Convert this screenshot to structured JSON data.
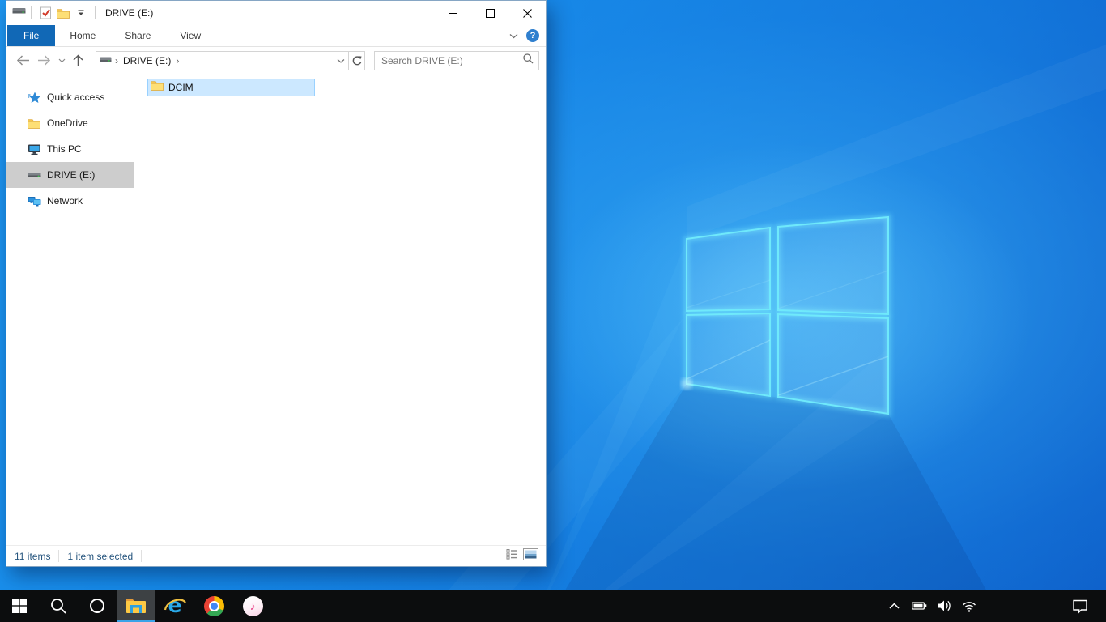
{
  "explorer": {
    "titlebar": {
      "title": "DRIVE (E:)",
      "system_icon": "drive-icon",
      "qat_icons": [
        "properties-icon",
        "new-folder-icon",
        "customize-qat-dropdown"
      ],
      "window_controls": [
        "minimize",
        "maximize",
        "close"
      ]
    },
    "ribbon": {
      "tabs": [
        "File",
        "Home",
        "Share",
        "View"
      ],
      "active_tab": "File",
      "right_icons": [
        "collapse-ribbon-chevron",
        "help"
      ]
    },
    "navbar": {
      "buttons": [
        "back",
        "forward",
        "recent-locations-chevron",
        "up"
      ],
      "crumb_drive": "DRIVE (E:)",
      "address_icons": [
        "drive-icon",
        "address-dropdown-chevron",
        "refresh"
      ],
      "search_placeholder": "Search DRIVE (E:)"
    },
    "sidebar": {
      "items": [
        {
          "label": "Quick access",
          "icon": "quick-access-star",
          "selected": false
        },
        {
          "label": "OneDrive",
          "icon": "folder",
          "selected": false
        },
        {
          "label": "This PC",
          "icon": "monitor",
          "selected": false
        },
        {
          "label": "DRIVE (E:)",
          "icon": "drive",
          "selected": true
        },
        {
          "label": "Network",
          "icon": "network",
          "selected": false
        }
      ]
    },
    "files": {
      "items": [
        {
          "name": "DCIM",
          "icon": "folder",
          "selected": true
        }
      ]
    },
    "statusbar": {
      "count": "11 items",
      "selection": "1 item selected",
      "view_icons": [
        "details-view",
        "large-thumbnails-view"
      ]
    }
  },
  "taskbar": {
    "buttons": [
      "start",
      "search",
      "cortana",
      "file-explorer",
      "internet-explorer",
      "chrome",
      "itunes"
    ],
    "active_app": "file-explorer",
    "tray_icons": [
      "show-hidden-chevron",
      "battery",
      "volume",
      "wifi"
    ],
    "corner_icons": [
      "action-center"
    ]
  },
  "colors": {
    "file_tab_blue": "#1168b6",
    "selection_fill": "#cce8ff",
    "selection_border": "#99d1ff",
    "sidebar_selected_gray": "#cdcdcd",
    "status_text_blue": "#26557e",
    "taskbar_black": "#0c0d0e",
    "taskbar_active_underline": "#3aa3e8",
    "wallpaper_logo_stroke": "#6fe9fb",
    "wallpaper_base_blue": "#0e6fd6"
  }
}
